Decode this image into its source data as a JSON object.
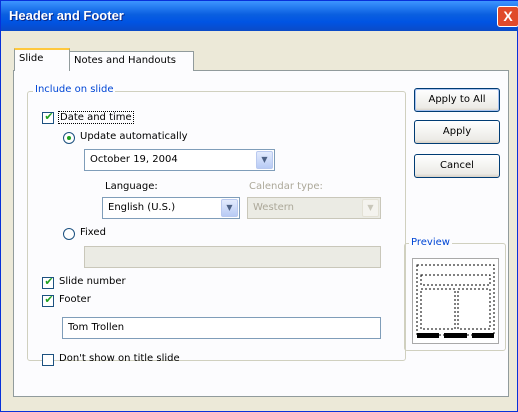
{
  "window": {
    "title": "Header and Footer",
    "close_glyph": "X"
  },
  "tabs": [
    {
      "label": "Slide",
      "active": true
    },
    {
      "label": "Notes and Handouts",
      "active": false
    }
  ],
  "include_group": {
    "legend": "Include on slide"
  },
  "date_time": {
    "label": "Date and time",
    "checked": true
  },
  "update_auto": {
    "label": "Update automatically",
    "selected": true,
    "value": "October 19, 2004"
  },
  "language": {
    "label": "Language:",
    "value": "English (U.S.)"
  },
  "calendar": {
    "label": "Calendar type:",
    "value": "Western",
    "disabled": true
  },
  "fixed": {
    "label": "Fixed",
    "selected": false,
    "value": ""
  },
  "slide_number": {
    "label": "Slide number",
    "checked": true
  },
  "footer": {
    "label": "Footer",
    "checked": true,
    "value": "Tom Trollen"
  },
  "dont_show": {
    "label": "Don't show on title slide",
    "checked": false
  },
  "buttons": {
    "apply_all": "Apply to All",
    "apply": "Apply",
    "cancel": "Cancel"
  },
  "preview": {
    "legend": "Preview"
  }
}
